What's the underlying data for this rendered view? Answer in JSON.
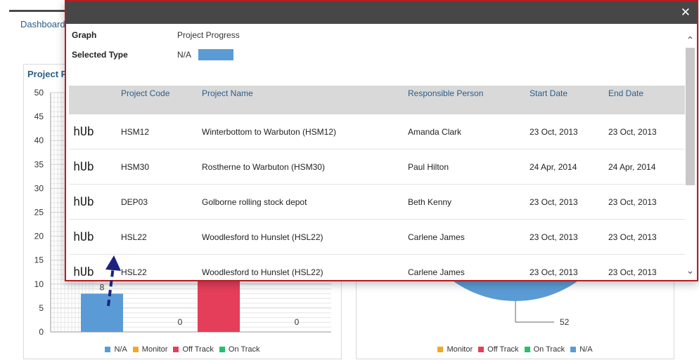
{
  "dashboard": {
    "tab_label": "Dashboard",
    "bar_panel_title": "Project Progress",
    "legend_bar": [
      {
        "label": "N/A",
        "color": "#5b9bd5"
      },
      {
        "label": "Monitor",
        "color": "#f5a623"
      },
      {
        "label": "Off Track",
        "color": "#e53e5a"
      },
      {
        "label": "On Track",
        "color": "#21c26b"
      }
    ],
    "legend_pie": [
      {
        "label": "Monitor",
        "color": "#f5a623"
      },
      {
        "label": "Off Track",
        "color": "#e53e5a"
      },
      {
        "label": "On Track",
        "color": "#21c26b"
      },
      {
        "label": "N/A",
        "color": "#5b9bd5"
      }
    ]
  },
  "chart_data": [
    {
      "type": "bar",
      "categories": [
        "",
        "",
        "",
        ""
      ],
      "series": [
        {
          "values": [
            8,
            0,
            35,
            0
          ],
          "colors": [
            "#5b9bd5",
            "#5b9bd5",
            "#e53e5a",
            "#e53e5a"
          ]
        }
      ],
      "value_labels": [
        "8",
        "0",
        "",
        "0"
      ],
      "yticks": [
        "0",
        "5",
        "10",
        "15",
        "20",
        "25",
        "30",
        "35",
        "40",
        "45",
        "50"
      ],
      "ylim": [
        0,
        50
      ],
      "grid": true
    },
    {
      "type": "pie",
      "slices": [
        {
          "label": "N/A",
          "value": 52,
          "color": "#5b9bd5"
        }
      ],
      "data_label": "52"
    }
  ],
  "modal": {
    "close_symbol": "✕",
    "graph_label": "Graph",
    "graph_value": "Project Progress",
    "type_label": "Selected Type",
    "type_value": "N/A",
    "type_color": "#5b9bd5",
    "columns": [
      "Project Code",
      "Project Name",
      "Responsible Person",
      "Start Date",
      "End Date"
    ],
    "rows": [
      {
        "logo": "hUb",
        "code": "HSM12",
        "name": "Winterbottom to Warbuton (HSM12)",
        "person": "Amanda Clark",
        "start": "23 Oct, 2013",
        "end": "23 Oct, 2013"
      },
      {
        "logo": "hUb",
        "code": "HSM30",
        "name": "Rostherne to Warbuton (HSM30)",
        "person": "Paul Hilton",
        "start": "24 Apr, 2014",
        "end": "24 Apr, 2014"
      },
      {
        "logo": "hUb",
        "code": "DEP03",
        "name": "Golborne rolling stock depot",
        "person": "Beth Kenny",
        "start": "23 Oct, 2013",
        "end": "23 Oct, 2013"
      },
      {
        "logo": "hUb",
        "code": "HSL22",
        "name": "Woodlesford to Hunslet (HSL22)",
        "person": "Carlene James",
        "start": "23 Oct, 2013",
        "end": "23 Oct, 2013"
      },
      {
        "logo": "hUb",
        "code": "HSL22",
        "name": "Woodlesford to Hunslet (HSL22)",
        "person": "Carlene James",
        "start": "23 Oct, 2013",
        "end": "23 Oct, 2013"
      }
    ]
  }
}
